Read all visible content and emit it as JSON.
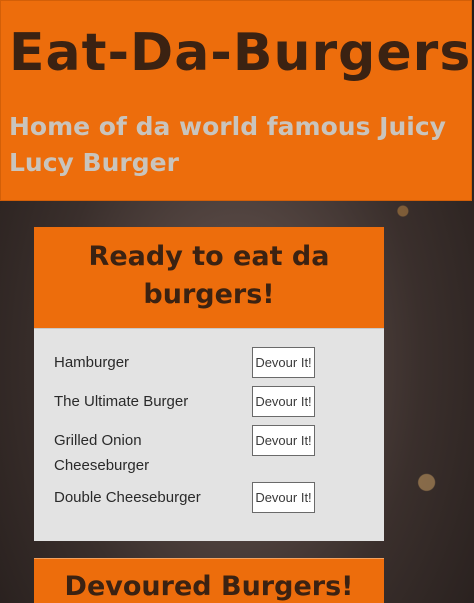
{
  "header": {
    "brand": "Eat-Da-Burgers",
    "tagline": "Home of da world famous Juicy Lucy Burger"
  },
  "ready": {
    "title_line1": "Ready to eat da",
    "title_line2": "burgers!",
    "button_label": "Devour It!",
    "burgers": [
      {
        "name": "Hamburger"
      },
      {
        "name": "The Ultimate Burger"
      },
      {
        "name_line1": "Grilled Onion",
        "name_line2": "Cheeseburger"
      },
      {
        "name": "Double Cheeseburger"
      }
    ]
  },
  "devoured": {
    "title": "Devoured Burgers!"
  },
  "colors": {
    "header_orange": "#ed6d0c",
    "title_brown": "#3b2212",
    "tagline_gray": "#c9c4bd",
    "panel_body_gray": "#e3e3e3"
  }
}
